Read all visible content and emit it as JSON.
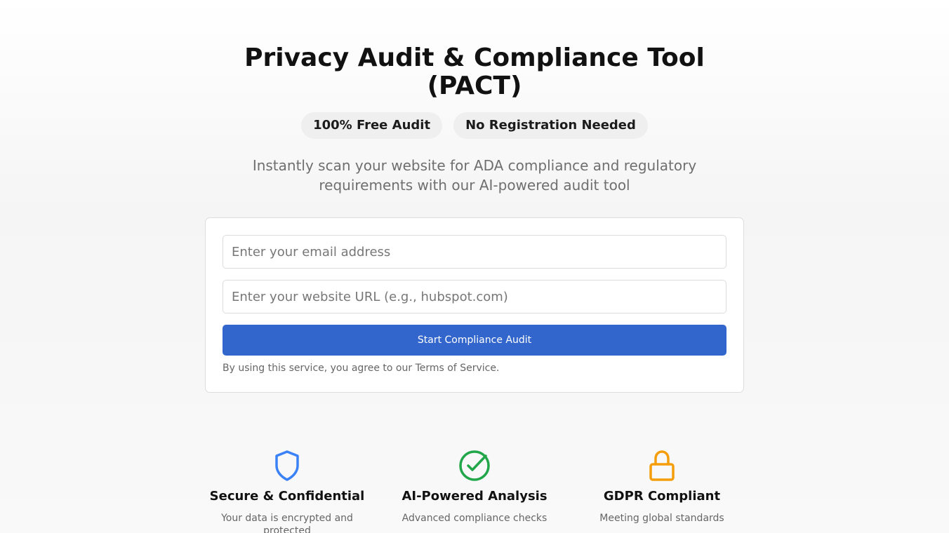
{
  "hero": {
    "title_line1": "Privacy Audit & Compliance Tool",
    "title_line2": "(PACT)",
    "badges": [
      "100% Free Audit",
      "No Registration Needed"
    ],
    "subtitle": "Instantly scan your website for ADA compliance and regulatory requirements with our AI-powered audit tool"
  },
  "form": {
    "email_placeholder": "Enter your email address",
    "email_value": "",
    "url_placeholder": "Enter your website URL (e.g., hubspot.com)",
    "url_value": "",
    "submit_label": "Start Compliance Audit",
    "terms_text": "By using this service, you agree to our Terms of Service."
  },
  "features": [
    {
      "icon": "shield-icon",
      "color": "#3b82f6",
      "title": "Secure & Confidential",
      "desc": "Your data is encrypted and protected"
    },
    {
      "icon": "check-circle-icon",
      "color": "#22a64a",
      "title": "AI-Powered Analysis",
      "desc": "Advanced compliance checks"
    },
    {
      "icon": "lock-icon",
      "color": "#f59e0b",
      "title": "GDPR Compliant",
      "desc": "Meeting global standards"
    }
  ],
  "colors": {
    "primary_button": "#3366cc"
  }
}
